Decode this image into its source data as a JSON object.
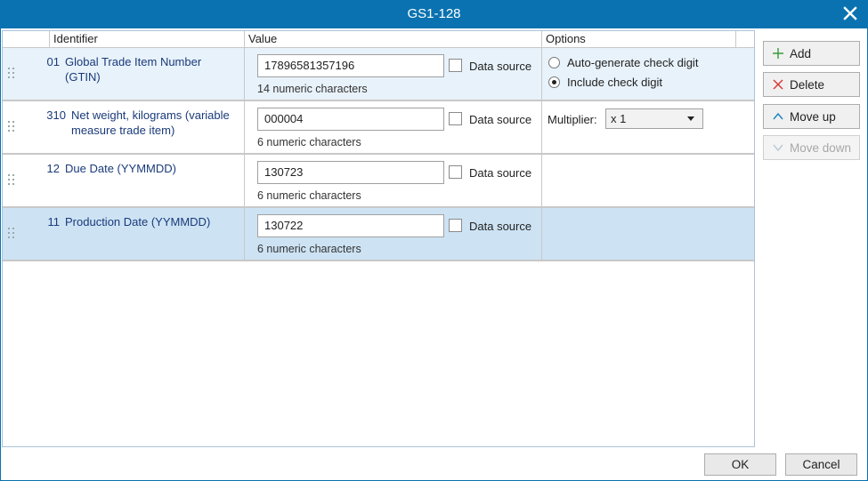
{
  "window": {
    "title": "GS1-128"
  },
  "grid": {
    "columns": {
      "identifier": "Identifier",
      "value": "Value",
      "options": "Options"
    },
    "rows": [
      {
        "code": "01",
        "name_line1": "Global Trade Item Number",
        "name_line2": "(GTIN)",
        "value": "17896581357196",
        "hint": "14 numeric characters",
        "data_source_label": "Data source",
        "data_source_checked": false,
        "options": {
          "type": "check_digit",
          "auto_label": "Auto-generate check digit",
          "include_label": "Include check digit",
          "selected": "include"
        }
      },
      {
        "code": "310",
        "name_line1": "Net weight, kilograms (variable",
        "name_line2": "measure trade item)",
        "value": "000004",
        "hint": "6 numeric characters",
        "data_source_label": "Data source",
        "data_source_checked": false,
        "options": {
          "type": "multiplier",
          "label": "Multiplier:",
          "selected": "x 1"
        }
      },
      {
        "code": "12",
        "name_line1": "Due Date (YYMMDD)",
        "name_line2": "",
        "value": "130723",
        "hint": "6 numeric characters",
        "data_source_label": "Data source",
        "data_source_checked": false
      },
      {
        "code": "11",
        "name_line1": "Production Date (YYMMDD)",
        "name_line2": "",
        "value": "130722",
        "hint": "6 numeric characters",
        "data_source_label": "Data source",
        "data_source_checked": false,
        "selected": true
      }
    ]
  },
  "side_buttons": {
    "add": "Add",
    "delete": "Delete",
    "move_up": "Move up",
    "move_down": "Move down"
  },
  "footer": {
    "ok": "OK",
    "cancel": "Cancel"
  },
  "colors": {
    "titlebar": "#0a72b0",
    "row_alt": "#e8f2fa",
    "row_selected": "#cde3f4",
    "identifier_text": "#1a3a7a",
    "add_icon": "#3a9a3a",
    "delete_icon": "#d83a3a",
    "move_icon": "#1a82c4"
  }
}
